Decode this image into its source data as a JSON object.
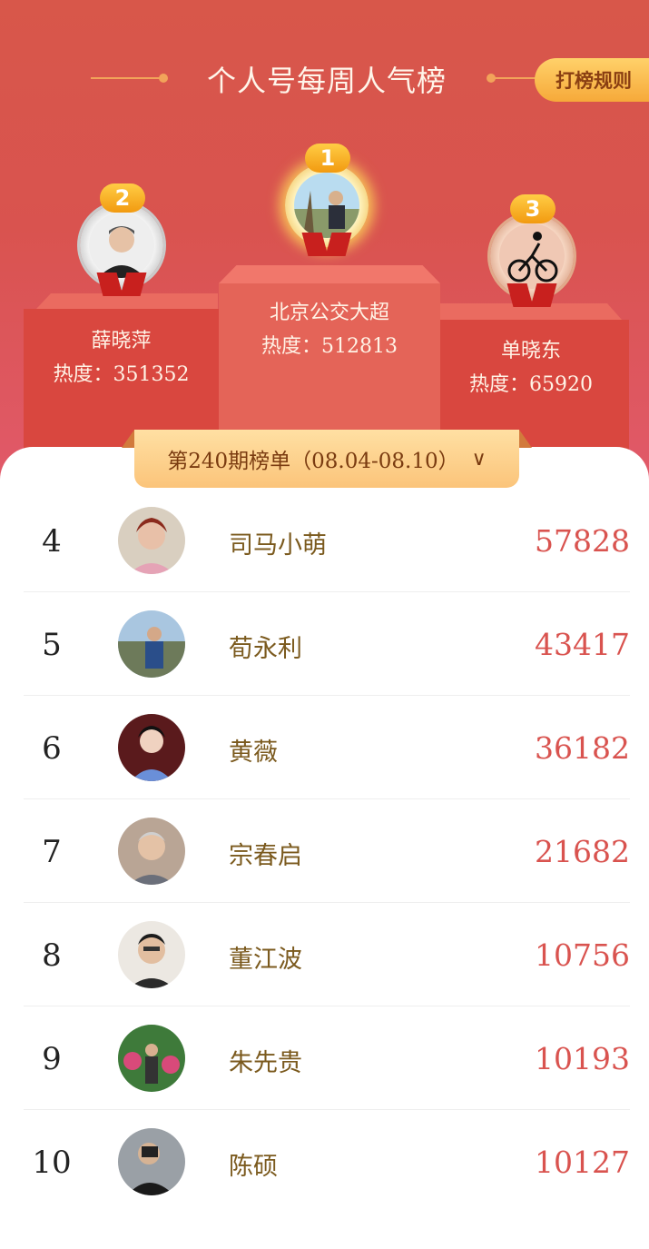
{
  "header": {
    "title": "个人号每周人气榜",
    "rule_button": "打榜规则"
  },
  "podium": {
    "first": {
      "rank": "1",
      "name": "北京公交大超",
      "heat_label": "热度：512813"
    },
    "second": {
      "rank": "2",
      "name": "薛晓萍",
      "heat_label": "热度：351352"
    },
    "third": {
      "rank": "3",
      "name": "单晓东",
      "heat_label": "热度：65920"
    }
  },
  "period": {
    "label": "第240期榜单（08.04-08.10）",
    "chevron_icon": "chevron-down-icon"
  },
  "list": [
    {
      "rank": "4",
      "name": "司马小萌",
      "heat": "57828"
    },
    {
      "rank": "5",
      "name": "荀永利",
      "heat": "43417"
    },
    {
      "rank": "6",
      "name": "黄薇",
      "heat": "36182"
    },
    {
      "rank": "7",
      "name": "宗春启",
      "heat": "21682"
    },
    {
      "rank": "8",
      "name": "董江波",
      "heat": "10756"
    },
    {
      "rank": "9",
      "name": "朱先贵",
      "heat": "10193"
    },
    {
      "rank": "10",
      "name": "陈硕",
      "heat": "10127"
    }
  ],
  "colors": {
    "header_red": "#d9534f",
    "gold": "#f6a93a",
    "heat_red": "#d9534f",
    "name_brown": "#7b5a1e"
  }
}
